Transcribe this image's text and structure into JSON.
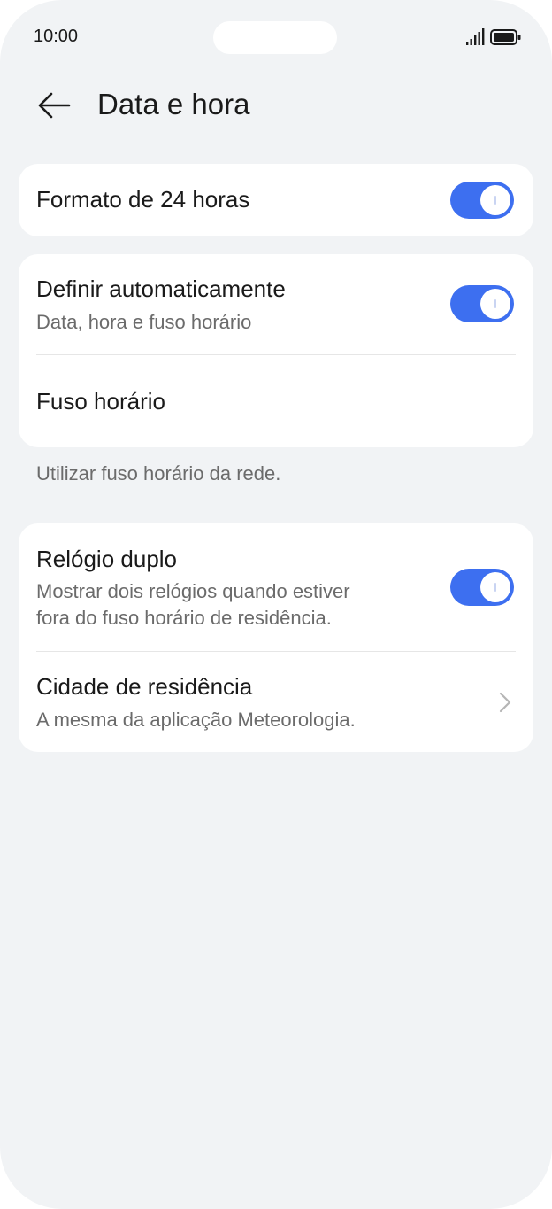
{
  "status_bar": {
    "time": "10:00",
    "signal_icon": "signal-bars-icon",
    "battery_icon": "battery-icon"
  },
  "header": {
    "back_icon": "arrow-left-icon",
    "title": "Data e hora"
  },
  "settings": {
    "format_24h": {
      "title": "Formato de 24 horas",
      "toggle_on": true
    },
    "auto_set": {
      "title": "Definir automaticamente",
      "subtitle": "Data, hora e fuso horário",
      "toggle_on": true
    },
    "timezone": {
      "title": "Fuso horário"
    },
    "timezone_note": "Utilizar fuso horário da rede.",
    "dual_clock": {
      "title": "Relógio duplo",
      "subtitle": "Mostrar dois relógios quando estiver\nfora do fuso horário de residência.",
      "toggle_on": true
    },
    "home_city": {
      "title": "Cidade de residência",
      "subtitle": "A mesma da aplicação Meteorologia.",
      "chevron_icon": "chevron-right-icon"
    }
  },
  "colors": {
    "background": "#f1f3f5",
    "card": "#ffffff",
    "accent": "#3d6ff0",
    "secondary_text": "#6b6b6b"
  }
}
